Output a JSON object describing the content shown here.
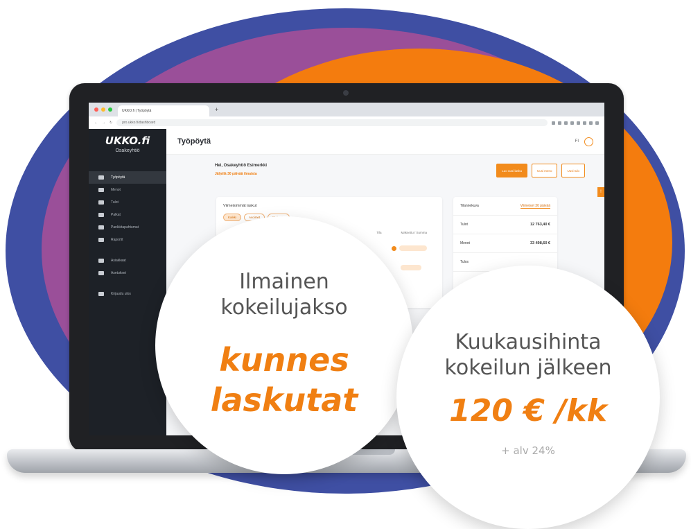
{
  "browser": {
    "tab_title": "UKKO.fi | Työpöytä",
    "url": "pro.ukko.fi/dashboard"
  },
  "sidebar": {
    "logo": "UKKO.fi",
    "subtitle": "Osakeyhtiö",
    "items": [
      {
        "label": "Työpöytä",
        "icon": "dashboard-icon",
        "active": true
      },
      {
        "label": "Menot",
        "icon": "list-icon"
      },
      {
        "label": "Tulot",
        "icon": "chart-icon"
      },
      {
        "label": "Palkat",
        "icon": "payroll-icon"
      },
      {
        "label": "Pankkitapahtumat",
        "icon": "bank-icon"
      },
      {
        "label": "Raportit",
        "icon": "report-icon"
      },
      {
        "label": "Asiakkaat",
        "icon": "customers-icon"
      },
      {
        "label": "Asetukset",
        "icon": "settings-icon"
      },
      {
        "label": "Kirjaudu ulos",
        "icon": "logout-icon"
      }
    ]
  },
  "header": {
    "title": "Työpöytä",
    "language": "FI"
  },
  "greeting": {
    "line": "Hei, Osakeyhtiö Esimerkki",
    "trial": "Jäljellä 30 päivää ilmaista"
  },
  "actions": [
    "Luo uusi lasku",
    "Uusi meno",
    "Uusi tulo"
  ],
  "invoices": {
    "heading": "Viimeisimmät laskut",
    "filters": [
      "Kaikki",
      "Avoimet",
      "Maksetut"
    ],
    "columns": [
      "Tila",
      "Maksettu / Summa"
    ]
  },
  "summary": {
    "heading": "Tilannekuva",
    "link": "Viimeiset 30 päivää",
    "rows": [
      {
        "label": "Tulot",
        "value": "12 763,40 €"
      },
      {
        "label": "Menot",
        "value": "33 498,60 €"
      },
      {
        "label": "Tulos",
        "value": ""
      }
    ]
  },
  "promo": {
    "left_heading": [
      "Ilmainen",
      "kokeilujakso"
    ],
    "left_accent": [
      "kunnes",
      "laskutat"
    ],
    "right_heading": [
      "Kuukausihinta",
      "kokeilun jälkeen"
    ],
    "right_price": "120 € /kk",
    "right_note": "+ alv 24%"
  },
  "colors": {
    "accent": "#f07f12",
    "blob_blue": "#3f4fa3",
    "blob_purple": "#9a4f99",
    "blob_orange": "#f47c0e",
    "sidebar_bg": "#1d2127"
  }
}
